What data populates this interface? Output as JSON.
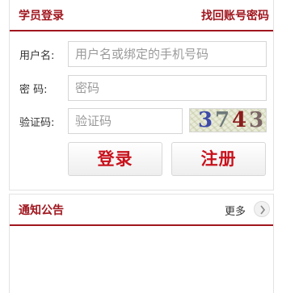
{
  "login": {
    "title": "学员登录",
    "retrieve_link": "找回账号密码",
    "username_label": "用户名:",
    "username_placeholder": "用户名或绑定的手机号码",
    "password_label": "密  码:",
    "password_placeholder": "密码",
    "captcha_label": "验证码:",
    "captcha_placeholder": "验证码",
    "captcha_digits": [
      "3",
      "7",
      "4",
      "3"
    ],
    "login_button": "登录",
    "register_button": "注册"
  },
  "notice": {
    "title": "通知公告",
    "more_label": "更多",
    "more_icon": "chevron-right-icon"
  },
  "colors": {
    "brand": "#a0161e",
    "button_text": "#c8121c"
  }
}
